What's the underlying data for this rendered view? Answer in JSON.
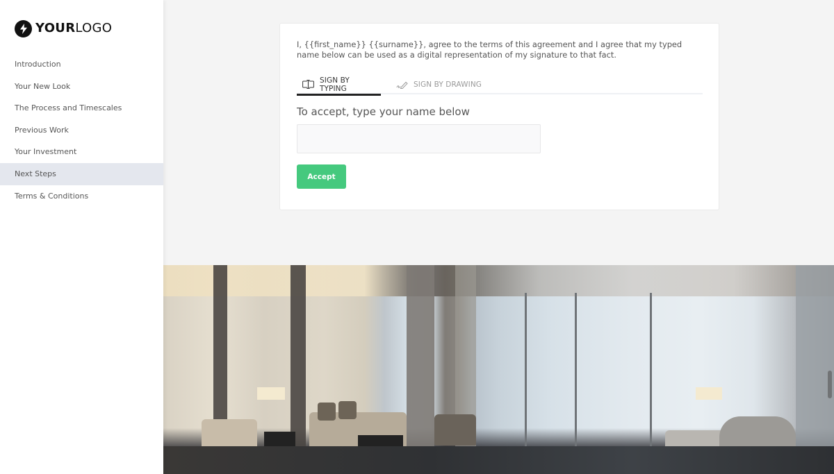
{
  "brand": {
    "logo_bold": "YOUR",
    "logo_light": "LOGO",
    "logo_icon": "lightning-bolt-icon"
  },
  "sidebar": {
    "items": [
      {
        "label": "Introduction",
        "active": false
      },
      {
        "label": "Your New Look",
        "active": false
      },
      {
        "label": "The Process and Timescales",
        "active": false
      },
      {
        "label": "Previous Work",
        "active": false
      },
      {
        "label": "Your Investment",
        "active": false
      },
      {
        "label": "Next Steps",
        "active": true
      },
      {
        "label": "Terms & Conditions",
        "active": false
      }
    ]
  },
  "signature": {
    "agreement_text": "I, {{first_name}} {{surname}}, agree to the terms of this agreement and I agree that my typed name below can be used as a digital representation of my signature to that fact.",
    "tabs": [
      {
        "label": "SIGN BY TYPING",
        "icon": "text-cursor-icon",
        "active": true
      },
      {
        "label": "SIGN BY DRAWING",
        "icon": "pen-signature-icon",
        "active": false
      }
    ],
    "accept_label": "To accept, type your name below",
    "name_input": {
      "value": "",
      "placeholder": ""
    },
    "accept_button": "Accept"
  },
  "colors": {
    "accent_green": "#45c97e",
    "active_nav_bg": "#e4e7ee",
    "page_bg": "#f4f4f4"
  },
  "hero": {
    "description": "interior-lounge-photo"
  }
}
